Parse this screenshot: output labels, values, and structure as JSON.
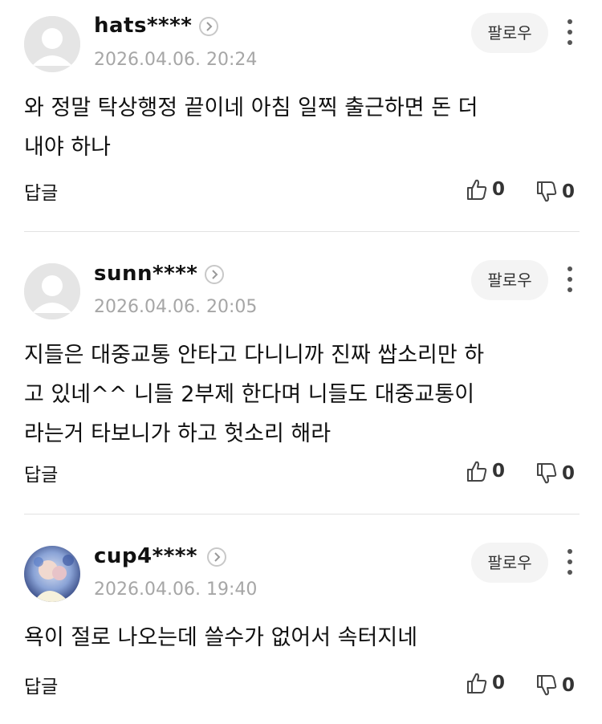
{
  "comments": [
    {
      "username": "hats****",
      "date": "2026.04.06. 20:24",
      "follow_label": "팔로우",
      "text_lines": [
        "와 정말 탁상행정 끝이네 아침 일찍 출근하면 돈 더",
        "내야 하나"
      ],
      "reply_label": "답글",
      "likes": "0",
      "dislikes": "0",
      "avatar": "default-avatar-icon"
    },
    {
      "username": "sunn****",
      "date": "2026.04.06. 20:05",
      "follow_label": "팔로우",
      "text_lines": [
        "지들은 대중교통 안타고 다니니까 진짜 쌉소리만 하",
        "고 있네^^ 니들 2부제 한다며 니들도 대중교통이",
        "라는거 타보니가 하고 헛소리 해라"
      ],
      "reply_label": "답글",
      "likes": "0",
      "dislikes": "0",
      "avatar": "default-avatar-icon"
    },
    {
      "username": "cup4****",
      "date": "2026.04.06. 19:40",
      "follow_label": "팔로우",
      "text_lines": [
        "욕이 절로 나오는데 쓸수가 없어서 속터지네"
      ],
      "reply_label": "답글",
      "likes": "0",
      "dislikes": "0",
      "avatar": "photo-avatar"
    }
  ],
  "colors": {
    "divider": "#e2e2e2",
    "date": "#a6a6a6",
    "follow_bg": "#f4f4f4"
  }
}
